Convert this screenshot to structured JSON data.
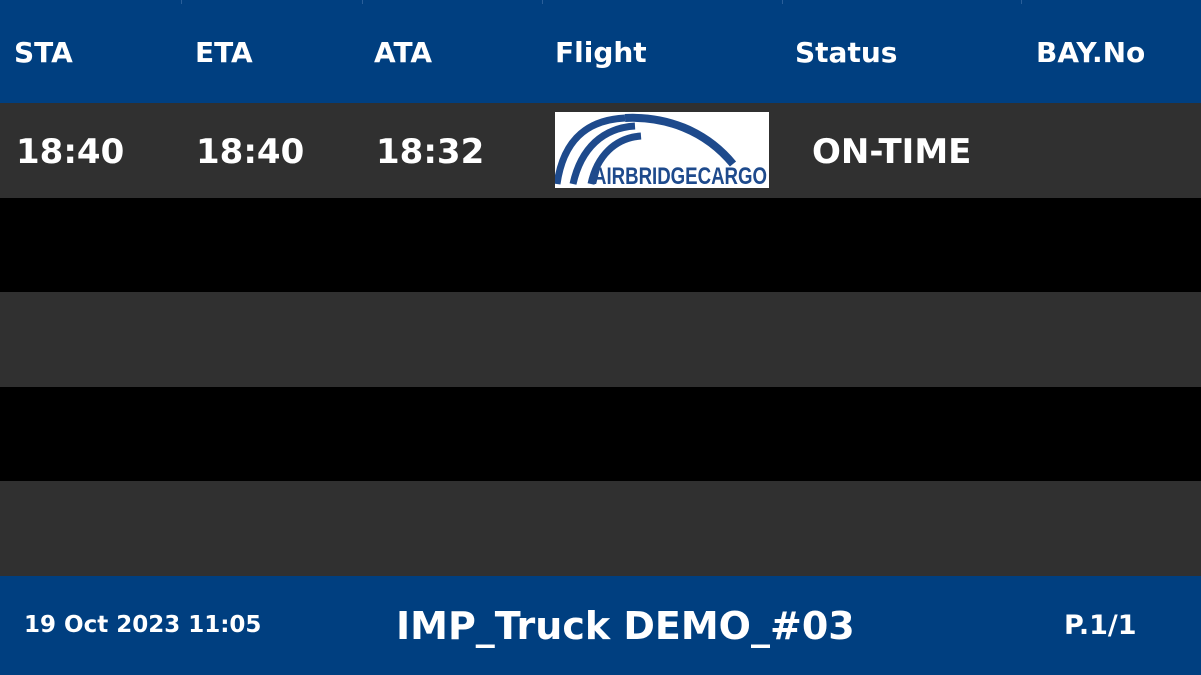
{
  "colors": {
    "header_bg": "#003f80",
    "row_dark": "#303030",
    "row_black": "#000000",
    "text": "#ffffff",
    "logo_blue": "#1e4a8c"
  },
  "columns": [
    "STA",
    "ETA",
    "ATA",
    "Flight",
    "Status",
    "BAY.No"
  ],
  "rows": [
    {
      "sta": "18:40",
      "eta": "18:40",
      "ata": "18:32",
      "flight_logo": {
        "icon": "airbridgecargo-logo",
        "text": "AIRBRIDGECARGO"
      },
      "status": "ON-TIME",
      "bay": ""
    }
  ],
  "footer": {
    "datetime": "19 Oct 2023 11:05",
    "title": "IMP_Truck DEMO_#03",
    "page": "P.1/1"
  }
}
